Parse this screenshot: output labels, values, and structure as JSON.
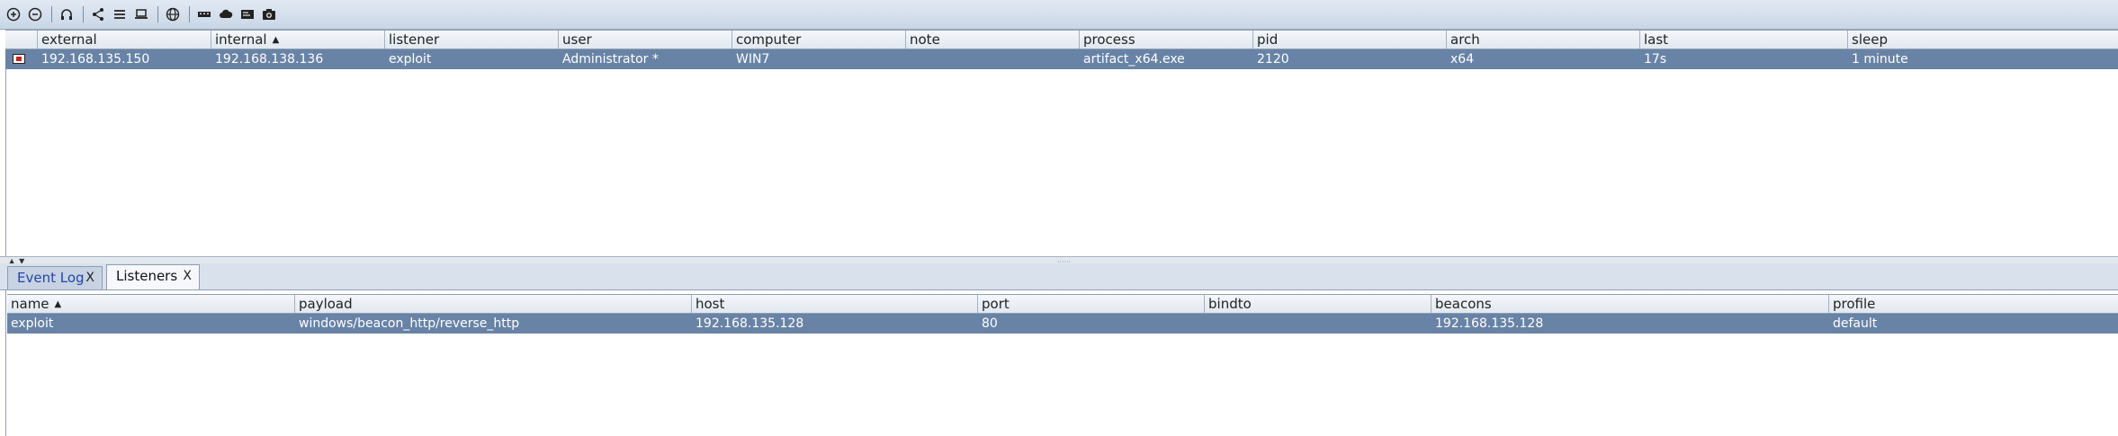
{
  "toolbar": {
    "icons": [
      "connect-icon",
      "disconnect-icon",
      "headphones-icon",
      "share-icon",
      "list-icon",
      "laptop-icon",
      "globe-icon",
      "keyboard-icon",
      "cloud-icon",
      "terminal-icon",
      "camera-icon"
    ]
  },
  "beacons_table": {
    "columns": [
      {
        "label": "",
        "sorted": false
      },
      {
        "label": "external",
        "sorted": false
      },
      {
        "label": "internal",
        "sorted": true
      },
      {
        "label": "listener",
        "sorted": false
      },
      {
        "label": "user",
        "sorted": false
      },
      {
        "label": "computer",
        "sorted": false
      },
      {
        "label": "note",
        "sorted": false
      },
      {
        "label": "process",
        "sorted": false
      },
      {
        "label": "pid",
        "sorted": false
      },
      {
        "label": "arch",
        "sorted": false
      },
      {
        "label": "last",
        "sorted": false
      },
      {
        "label": "sleep",
        "sorted": false
      }
    ],
    "rows": [
      {
        "external": "192.168.135.150",
        "internal": "192.168.138.136",
        "listener": "exploit",
        "user": "Administrator *",
        "computer": "WIN7",
        "note": "",
        "process": "artifact_x64.exe",
        "pid": "2120",
        "arch": "x64",
        "last": "17s",
        "sleep": "1 minute"
      }
    ]
  },
  "tabs": [
    {
      "label": "Event Log",
      "close": "X"
    },
    {
      "label": "Listeners",
      "close": "X"
    }
  ],
  "listeners_table": {
    "columns": [
      {
        "label": "name",
        "sorted": true
      },
      {
        "label": "payload",
        "sorted": false
      },
      {
        "label": "host",
        "sorted": false
      },
      {
        "label": "port",
        "sorted": false
      },
      {
        "label": "bindto",
        "sorted": false
      },
      {
        "label": "beacons",
        "sorted": false
      },
      {
        "label": "profile",
        "sorted": false
      }
    ],
    "rows": [
      {
        "name": "exploit",
        "payload": "windows/beacon_http/reverse_http",
        "host": "192.168.135.128",
        "port": "80",
        "bindto": "",
        "beacons": "192.168.135.128",
        "profile": "default"
      }
    ]
  },
  "sort_arrow": "▲",
  "colors": {
    "selected_row": "#6883a6",
    "tab_link": "#2345a8"
  }
}
